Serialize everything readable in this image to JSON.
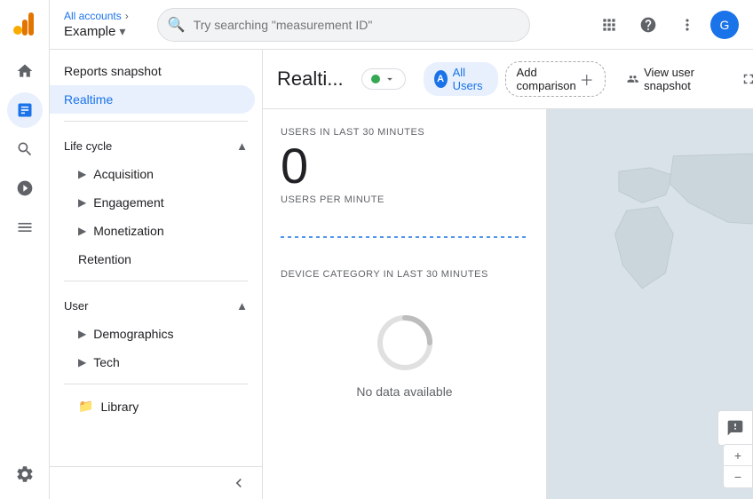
{
  "topbar": {
    "account_name": "All accounts",
    "breadcrumb_separator": "›",
    "property_name": "Example",
    "search_placeholder": "Try searching \"measurement ID\"",
    "icons": [
      "apps",
      "help",
      "more_vert"
    ]
  },
  "sidebar": {
    "nav_icons": [
      {
        "name": "home",
        "symbol": "⌂",
        "active": false
      },
      {
        "name": "reports",
        "symbol": "📊",
        "active": true
      },
      {
        "name": "explore",
        "symbol": "🔍",
        "active": false
      },
      {
        "name": "advertising",
        "symbol": "📣",
        "active": false
      },
      {
        "name": "configure",
        "symbol": "⚙",
        "active": false
      }
    ],
    "top_items": [
      {
        "label": "Reports snapshot",
        "active": false
      },
      {
        "label": "Realtime",
        "active": true
      }
    ],
    "sections": [
      {
        "title": "Life cycle",
        "expanded": true,
        "items": [
          {
            "label": "Acquisition",
            "expandable": true
          },
          {
            "label": "Engagement",
            "expandable": true
          },
          {
            "label": "Monetization",
            "expandable": true
          },
          {
            "label": "Retention",
            "expandable": false
          }
        ]
      },
      {
        "title": "User",
        "expanded": true,
        "items": [
          {
            "label": "Demographics",
            "expandable": true
          },
          {
            "label": "Tech",
            "expandable": true
          }
        ]
      }
    ],
    "bottom_items": [
      {
        "label": "Library",
        "icon": "📁"
      }
    ]
  },
  "content": {
    "title": "Realti...",
    "status": {
      "active": true,
      "dot_color": "#34a853"
    },
    "all_users_label": "All Users",
    "add_comparison_label": "Add comparison",
    "actions": [
      {
        "label": "View user snapshot",
        "icon": "👤"
      },
      {
        "icon": "⛶"
      },
      {
        "icon": "📊"
      },
      {
        "icon": "↗"
      }
    ],
    "stats": {
      "users_label": "USERS IN LAST 30 MINUTES",
      "users_value": "0",
      "users_per_minute_label": "USERS PER MINUTE",
      "device_category_label": "DEVICE CATEGORY IN LAST 30 MINUTES",
      "no_data_text": "No data available"
    }
  }
}
